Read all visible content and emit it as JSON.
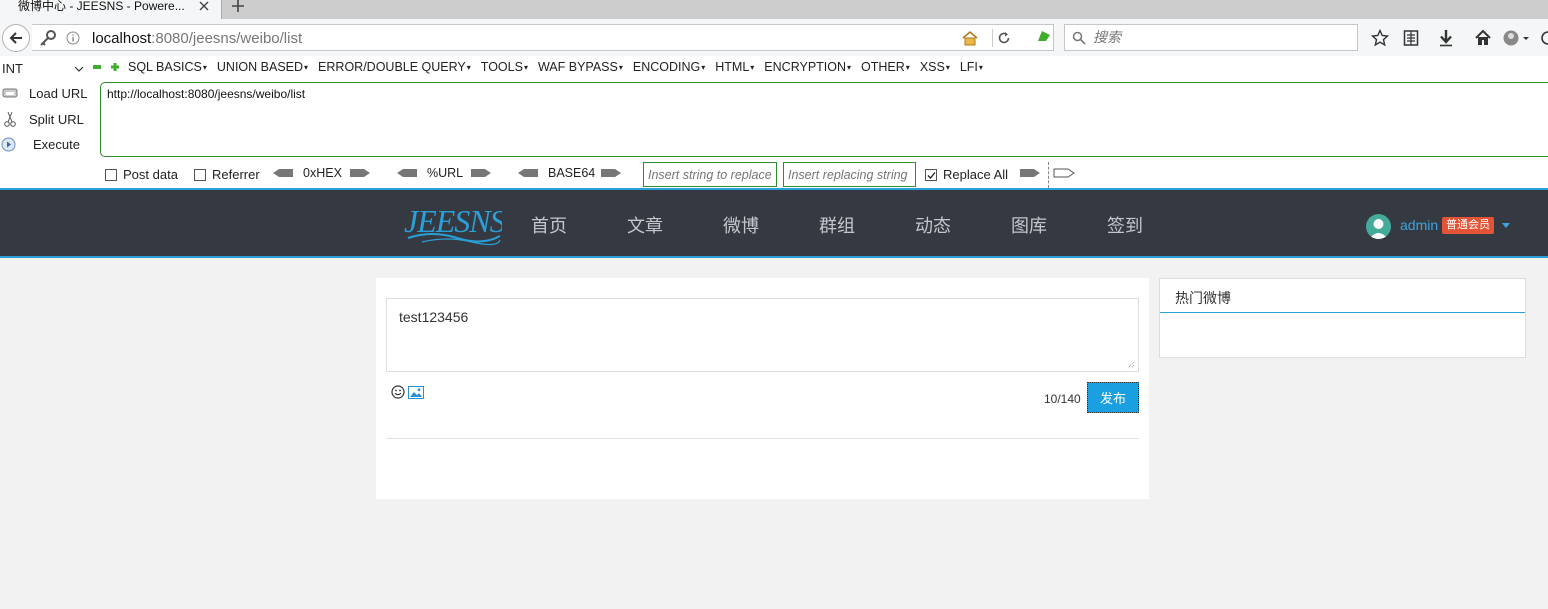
{
  "browser": {
    "tab_title": "微博中心 - JEESNS - Powere...",
    "url_host": "localhost",
    "url_rest": ":8080/jeesns/weibo/list",
    "search_placeholder": "搜索"
  },
  "hackbar": {
    "type_select": "INT",
    "menus": [
      "SQL BASICS",
      "UNION BASED",
      "ERROR/DOUBLE QUERY",
      "TOOLS",
      "WAF BYPASS",
      "ENCODING",
      "HTML",
      "ENCRYPTION",
      "OTHER",
      "XSS",
      "LFI"
    ],
    "load_url": "Load URL",
    "split_url": "Split URL",
    "execute": "Execute",
    "url_value": "http://localhost:8080/jeesns/weibo/list",
    "post_data": "Post data",
    "referrer": "Referrer",
    "hex": "0xHEX",
    "urlenc": "%URL",
    "base64": "BASE64",
    "insert_replace_placeholder": "Insert string to replace",
    "insert_replacing_placeholder": "Insert replacing string",
    "replace_all": "Replace All"
  },
  "site": {
    "nav": [
      "首页",
      "文章",
      "微博",
      "群组",
      "动态",
      "图库",
      "签到"
    ],
    "username": "admin",
    "member_badge": "普通会员"
  },
  "composer": {
    "text": "test123456",
    "char_count": "10/140",
    "publish_label": "发布"
  },
  "sidebar": {
    "hot_title": "热门微博"
  },
  "colors": {
    "header_bg": "#353a42",
    "accent": "#2aa0d8",
    "publish_btn": "#1a9fe0",
    "badge": "#e35436",
    "hackbar_border": "#2e8b2e"
  }
}
